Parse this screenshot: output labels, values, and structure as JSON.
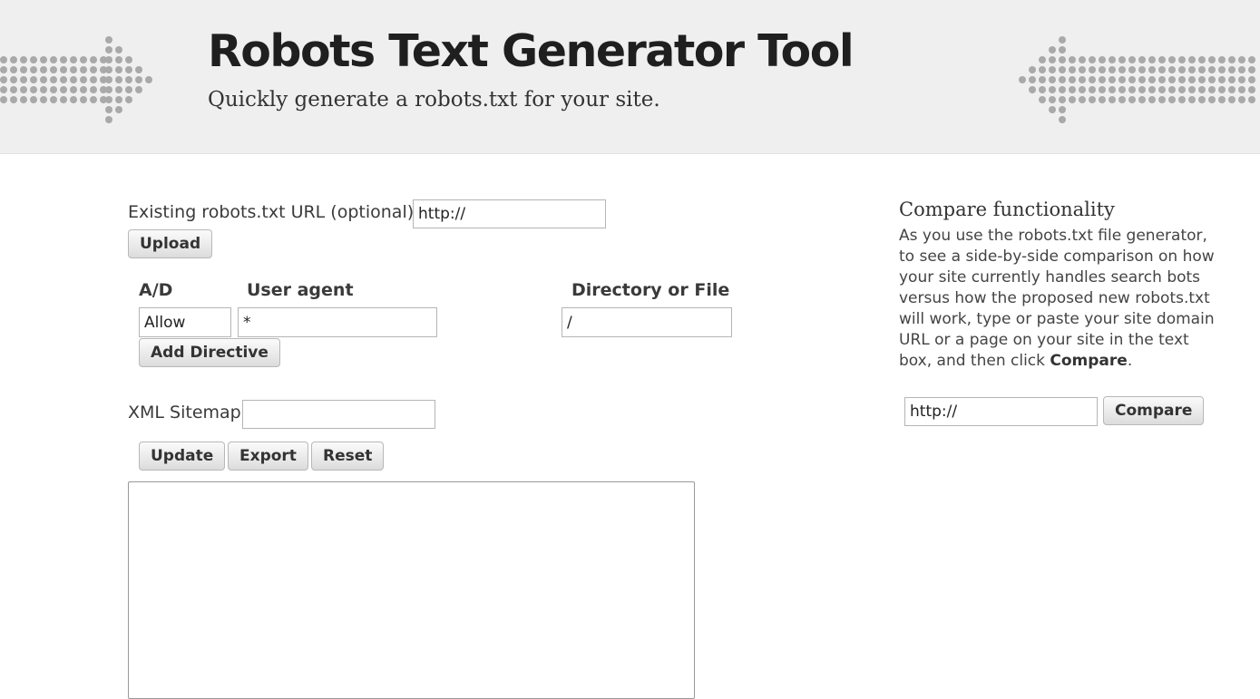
{
  "header": {
    "title": "Robots Text Generator Tool",
    "subtitle": "Quickly generate a robots.txt for your site."
  },
  "upload_section": {
    "label": "Existing robots.txt URL (optional):",
    "url_value": "http://",
    "upload_label": "Upload"
  },
  "directives": {
    "columns": [
      "A/D",
      "User agent",
      "Directory or File"
    ],
    "row": {
      "ad_value": "Allow",
      "user_agent_value": "*",
      "path_value": "/"
    },
    "add_label": "Add Directive"
  },
  "sitemap": {
    "label": "XML Sitemap",
    "value": ""
  },
  "actions": {
    "update_label": "Update",
    "export_label": "Export",
    "reset_label": "Reset"
  },
  "output": {
    "value": ""
  },
  "compare": {
    "heading": "Compare functionality",
    "description_main": "As you use the robots.txt file generator, to see a side-by-side comparison on how your site currently handles search bots versus how the proposed new robots.txt will work, type or paste your site domain URL or a page on your site in the text box, and then click ",
    "description_bold": "Compare",
    "description_end": ".",
    "url_value": "http://",
    "compare_label": "Compare"
  },
  "colors": {
    "header_bg": "#efefef",
    "dots": "#a9a9a9",
    "title": "#1f1f1f"
  },
  "icons": {
    "left_decoration": "dotted-arrow-right-icon",
    "right_decoration": "dotted-arrow-left-icon"
  }
}
